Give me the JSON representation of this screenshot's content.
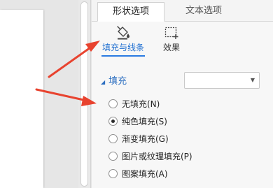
{
  "colors": {
    "accent_blue": "#2a7ae2",
    "annotation_red": "#e8432f",
    "pane_bg": "#f7f7f7"
  },
  "pane": {
    "tabs": [
      {
        "label": "形状选项",
        "active": true
      },
      {
        "label": "文本选项",
        "active": false
      }
    ],
    "subtabs": [
      {
        "label": "填充与线条",
        "icon": "paint-bucket-icon",
        "active": true
      },
      {
        "label": "效果",
        "icon": "effects-icon",
        "active": false
      }
    ],
    "fill_section": {
      "title": "填充",
      "expanded": true,
      "dropdown_value": ""
    },
    "fill_options": [
      {
        "label": "无填充(N)",
        "checked": false
      },
      {
        "label": "纯色填充(S)",
        "checked": true
      },
      {
        "label": "渐变填充(G)",
        "checked": false
      },
      {
        "label": "图片或纹理填充(P)",
        "checked": false
      },
      {
        "label": "图案填充(A)",
        "checked": false
      }
    ]
  }
}
